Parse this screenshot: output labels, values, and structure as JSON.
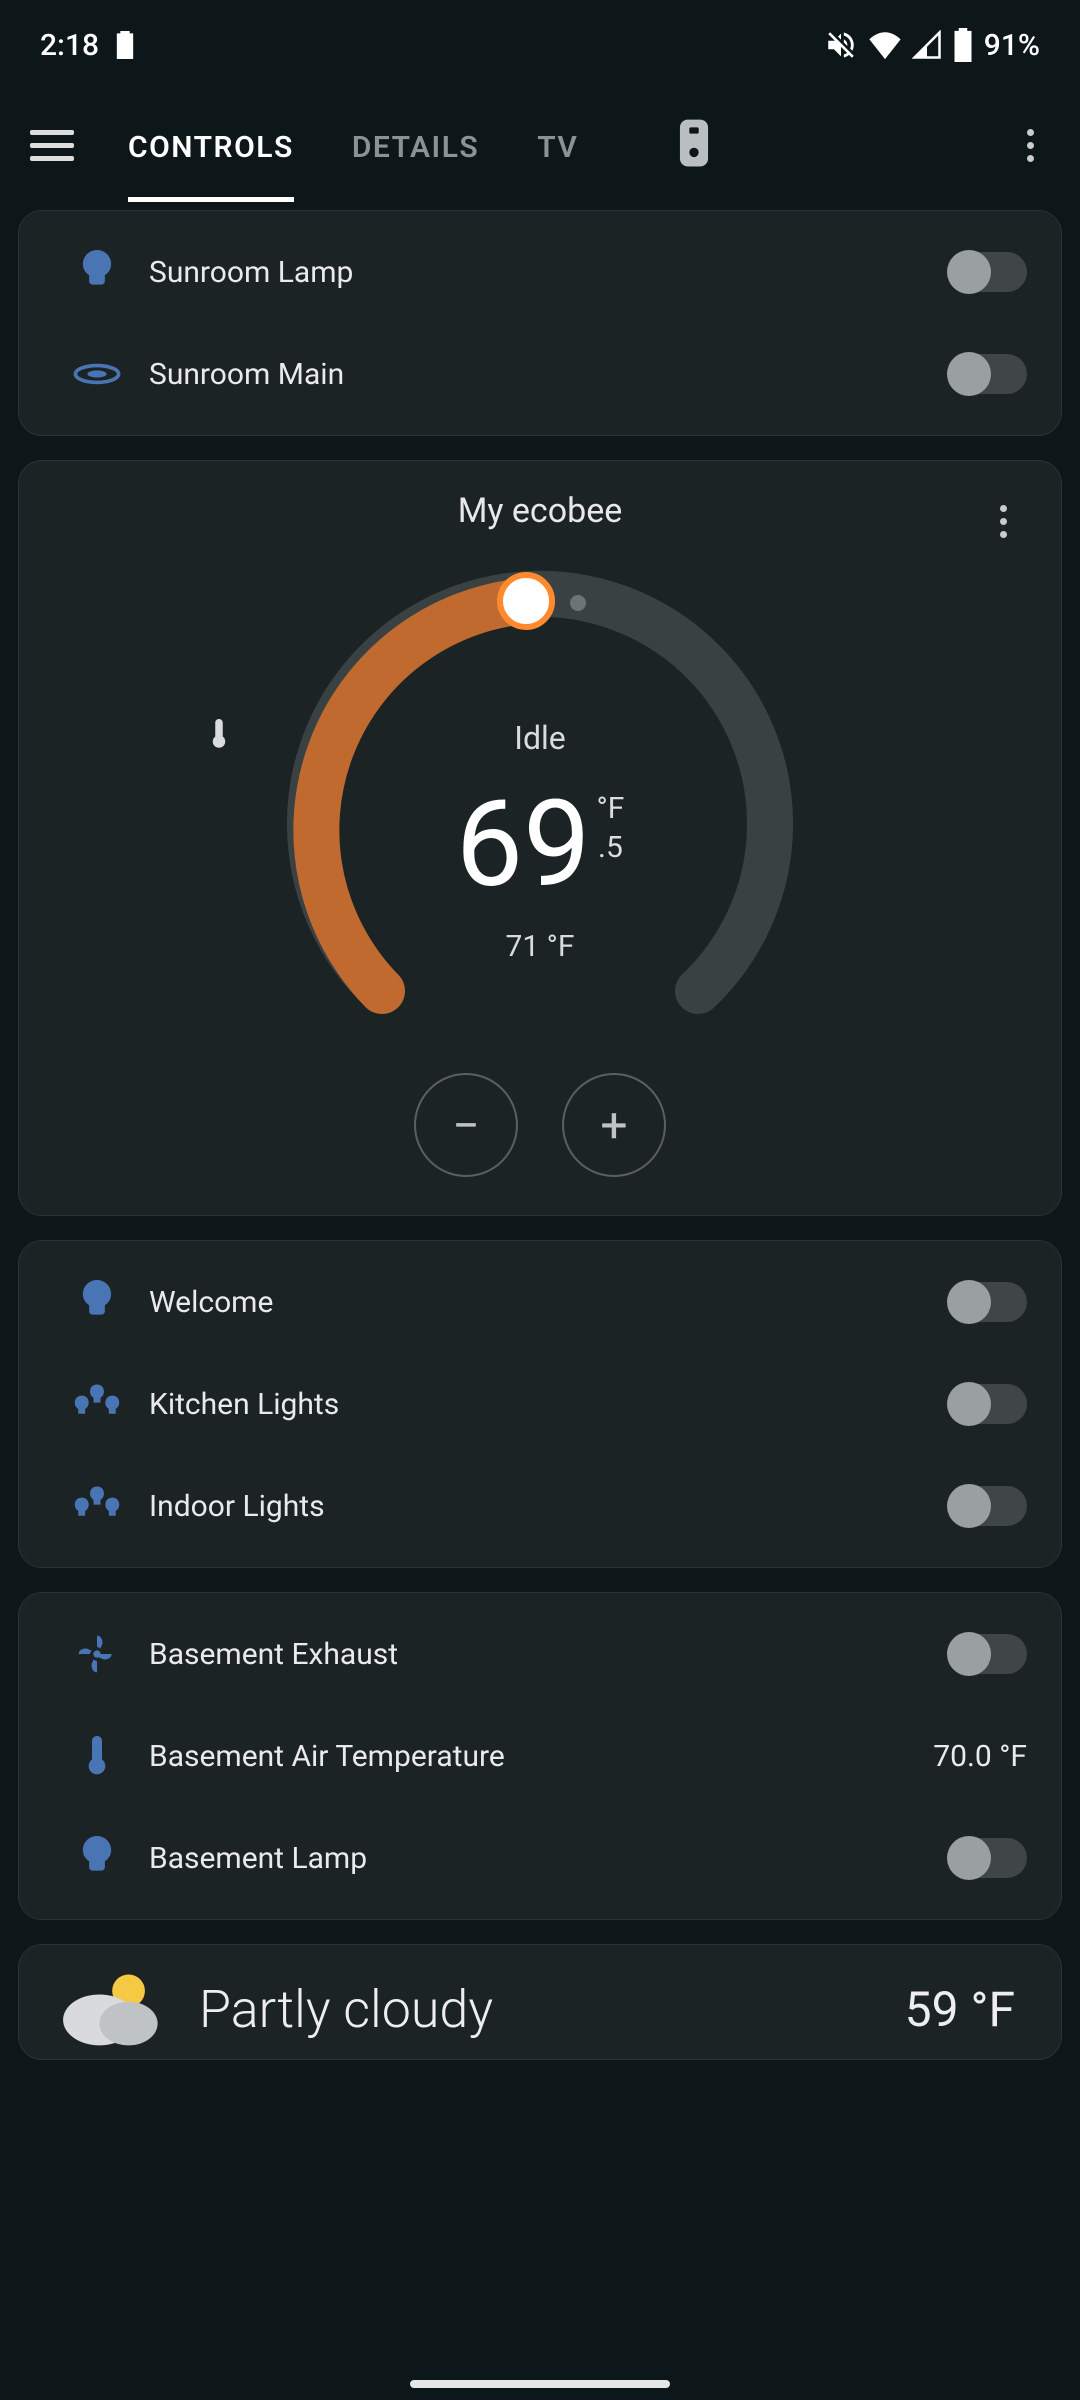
{
  "status": {
    "time": "2:18",
    "battery": "91%"
  },
  "tabs": {
    "controls": "CONTROLS",
    "details": "DETAILS",
    "tv": "TV"
  },
  "card1": {
    "items": [
      {
        "label": "Sunroom Lamp"
      },
      {
        "label": "Sunroom Main"
      }
    ]
  },
  "thermostat": {
    "title": "My ecobee",
    "state": "Idle",
    "temp_int": "69",
    "temp_unit": "°F",
    "temp_frac": ".5",
    "sensor": "71 °F"
  },
  "card3": {
    "items": [
      {
        "label": "Welcome"
      },
      {
        "label": "Kitchen Lights"
      },
      {
        "label": "Indoor Lights"
      }
    ]
  },
  "card4": {
    "exhaust": "Basement Exhaust",
    "airtemp_label": "Basement Air Temperature",
    "airtemp_value": "70.0 °F",
    "lamp": "Basement Lamp"
  },
  "weather": {
    "condition": "Partly cloudy",
    "temp": "59 °F"
  }
}
